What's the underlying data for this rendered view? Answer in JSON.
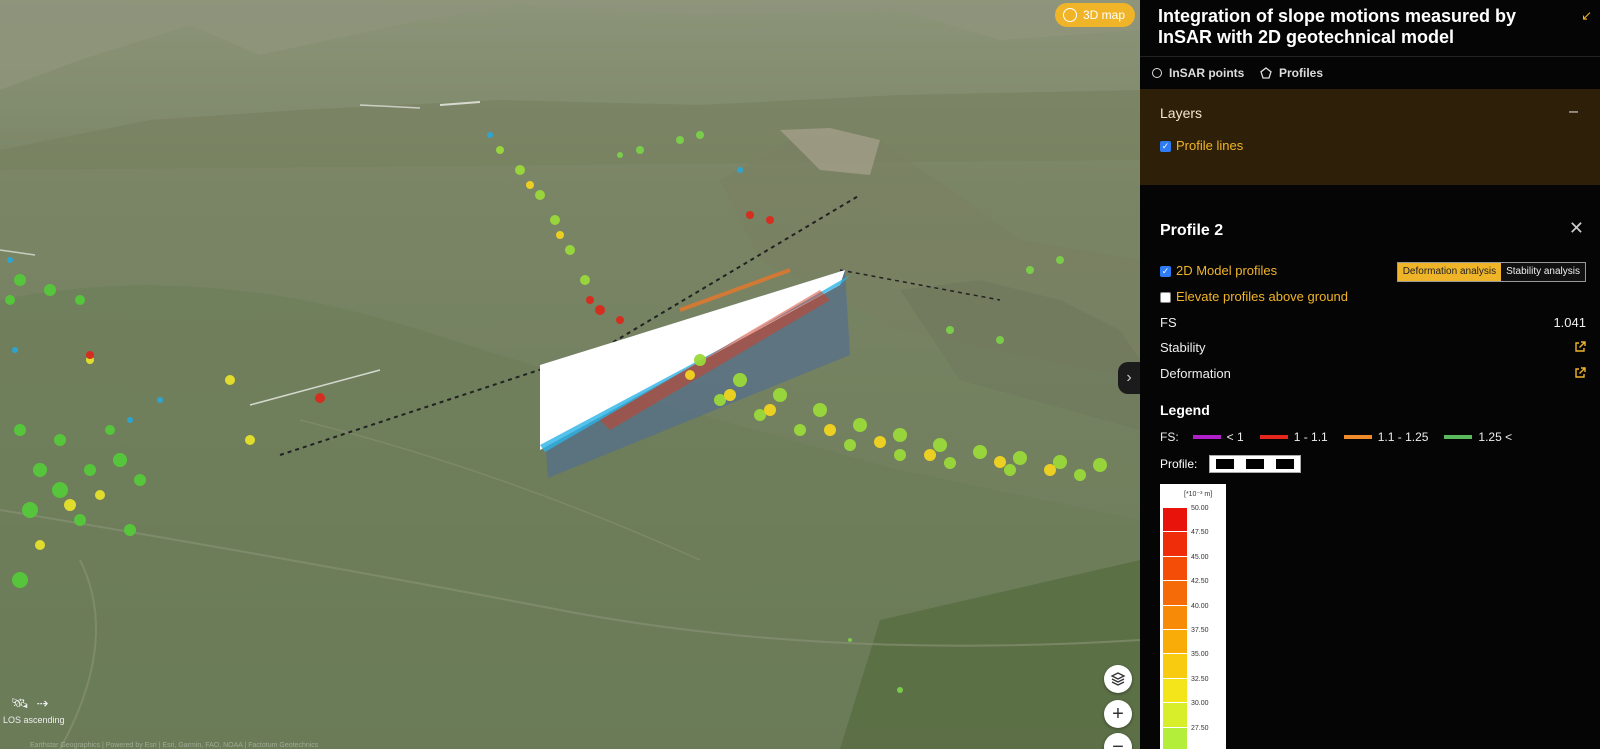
{
  "map": {
    "mode_button": {
      "label": "3D map",
      "icon": "cube-icon"
    },
    "los_label": "LOS ascending",
    "attribution": "Earthstar Geographics | Powered by Esri | Esri, Garmin, FAO, NOAA | Factotum Geotechnics",
    "controls": {
      "layers_icon": "layers-icon",
      "zoom_in": "+",
      "zoom_out": "−"
    },
    "collapse_icon": "chevron-right-icon"
  },
  "panel": {
    "title": "Integration of slope motions measured by InSAR with 2D geotechnical model",
    "minimize_icon": "arrow-down-left-icon",
    "tabs": [
      {
        "label": "InSAR points",
        "icon": "circle-icon",
        "active": false
      },
      {
        "label": "Profiles",
        "icon": "pentagon-icon",
        "active": true
      }
    ],
    "layers": {
      "header": "Layers",
      "collapse": "–",
      "items": [
        {
          "label": "Profile lines",
          "checked": true
        }
      ]
    },
    "profile": {
      "title": "Profile 2",
      "close": "✕",
      "model_profiles": {
        "label": "2D Model profiles",
        "checked": true
      },
      "elevate": {
        "label": "Elevate profiles above ground",
        "checked": false
      },
      "analysis_buttons": [
        {
          "label": "Deformation analysis",
          "active": true
        },
        {
          "label": "Stability analysis",
          "active": false
        }
      ],
      "fs_label": "FS",
      "fs_value": "1.041",
      "stability_label": "Stability",
      "deformation_label": "Deformation"
    },
    "legend": {
      "title": "Legend",
      "fs_label": "FS:",
      "fs_items": [
        {
          "label": "< 1",
          "color": "#b01fc9"
        },
        {
          "label": "1 - 1.1",
          "color": "#e4261b"
        },
        {
          "label": "1.1 - 1.25",
          "color": "#f08a2b"
        },
        {
          "label": "1.25 <",
          "color": "#5cb85c"
        }
      ],
      "profile_label": "Profile:",
      "colorbar": {
        "unit": "[*10⁻³ m]",
        "labels": [
          "50.00",
          "47.50",
          "45.00",
          "42.50",
          "40.00",
          "37.50",
          "35.00",
          "32.50",
          "30.00",
          "27.50"
        ],
        "colors": [
          "#e8140c",
          "#ef2d0a",
          "#f34d08",
          "#f56b07",
          "#f78a06",
          "#f9ab08",
          "#f9cb10",
          "#f4e51a",
          "#d8ee2a",
          "#b3ee3a"
        ]
      }
    }
  }
}
